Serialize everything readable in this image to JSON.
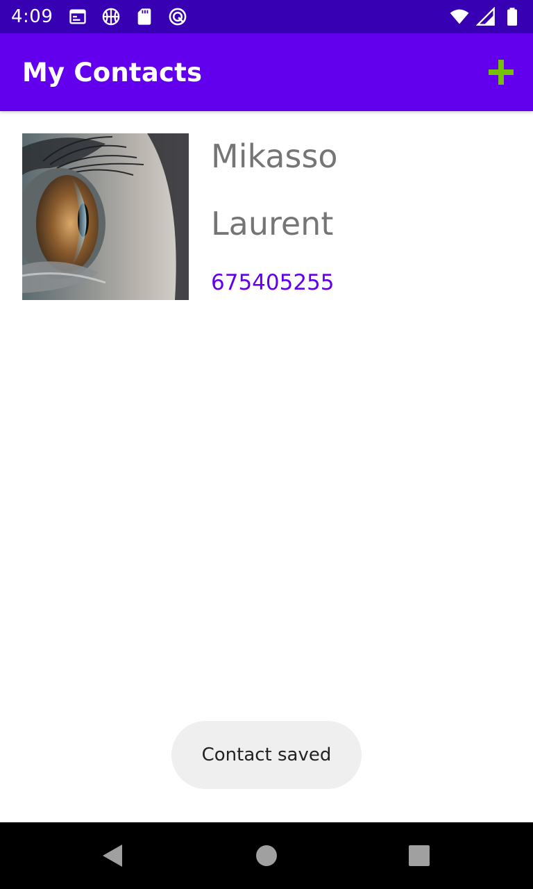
{
  "status_bar": {
    "time": "4:09",
    "left_icons": [
      "calendar-icon",
      "basketball-icon",
      "sd-card-icon",
      "sync-icon"
    ],
    "right_icons": [
      "wifi-icon",
      "cell-signal-icon",
      "battery-icon"
    ]
  },
  "app_bar": {
    "title": "My Contacts",
    "add_icon": "plus-icon",
    "accent": "#6200ee",
    "add_icon_color": "#76c00a"
  },
  "contacts": [
    {
      "first_name": "Mikasso",
      "last_name": "Laurent",
      "phone": "675405255",
      "photo": "eye-closeup-photo"
    }
  ],
  "toast": {
    "message": "Contact saved"
  },
  "nav_bar": {
    "buttons": [
      "back-icon",
      "home-icon",
      "recents-icon"
    ]
  }
}
